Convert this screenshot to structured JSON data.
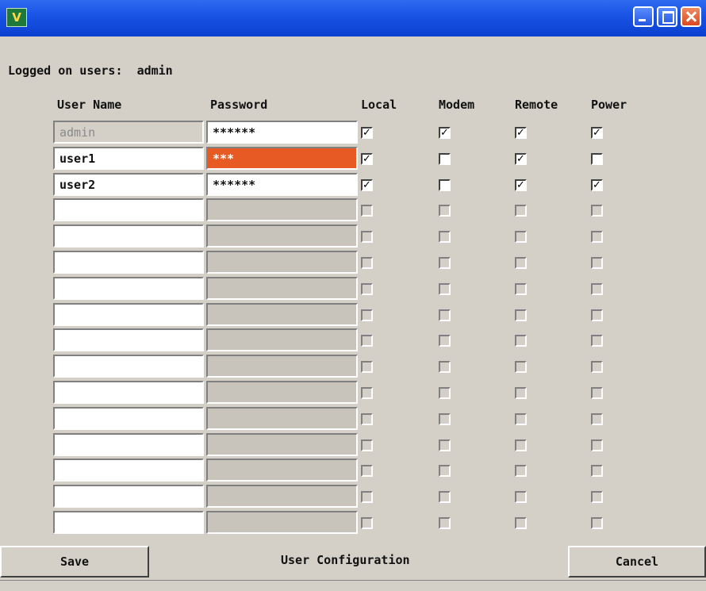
{
  "window": {
    "app_icon_text": "V",
    "logged_label": "Logged on users:",
    "logged_user": "admin",
    "caption": "User Configuration"
  },
  "columns": {
    "user_name": "User Name",
    "password": "Password",
    "local": "Local",
    "modem": "Modem",
    "remote": "Remote",
    "power": "Power"
  },
  "rows": [
    {
      "user": "admin",
      "password": "******",
      "local": true,
      "modem": true,
      "remote": true,
      "power": true,
      "state": "locked"
    },
    {
      "user": "user1",
      "password": "***",
      "local": true,
      "modem": false,
      "remote": true,
      "power": false,
      "state": "editing"
    },
    {
      "user": "user2",
      "password": "******",
      "local": true,
      "modem": false,
      "remote": true,
      "power": true,
      "state": "active"
    },
    {
      "user": "",
      "password": "",
      "local": false,
      "modem": false,
      "remote": false,
      "power": false,
      "state": "empty"
    },
    {
      "user": "",
      "password": "",
      "local": false,
      "modem": false,
      "remote": false,
      "power": false,
      "state": "empty"
    },
    {
      "user": "",
      "password": "",
      "local": false,
      "modem": false,
      "remote": false,
      "power": false,
      "state": "empty"
    },
    {
      "user": "",
      "password": "",
      "local": false,
      "modem": false,
      "remote": false,
      "power": false,
      "state": "empty"
    },
    {
      "user": "",
      "password": "",
      "local": false,
      "modem": false,
      "remote": false,
      "power": false,
      "state": "empty"
    },
    {
      "user": "",
      "password": "",
      "local": false,
      "modem": false,
      "remote": false,
      "power": false,
      "state": "empty"
    },
    {
      "user": "",
      "password": "",
      "local": false,
      "modem": false,
      "remote": false,
      "power": false,
      "state": "empty"
    },
    {
      "user": "",
      "password": "",
      "local": false,
      "modem": false,
      "remote": false,
      "power": false,
      "state": "empty"
    },
    {
      "user": "",
      "password": "",
      "local": false,
      "modem": false,
      "remote": false,
      "power": false,
      "state": "empty"
    },
    {
      "user": "",
      "password": "",
      "local": false,
      "modem": false,
      "remote": false,
      "power": false,
      "state": "empty"
    },
    {
      "user": "",
      "password": "",
      "local": false,
      "modem": false,
      "remote": false,
      "power": false,
      "state": "empty"
    },
    {
      "user": "",
      "password": "",
      "local": false,
      "modem": false,
      "remote": false,
      "power": false,
      "state": "empty"
    },
    {
      "user": "",
      "password": "",
      "local": false,
      "modem": false,
      "remote": false,
      "power": false,
      "state": "empty"
    }
  ],
  "buttons": {
    "save": "Save",
    "cancel": "Cancel"
  },
  "colors": {
    "titlebar": "#1a55e6",
    "editing_field": "#e85a24",
    "dialog_bg": "#d4d0c8"
  },
  "icons": {
    "app": "vc-app-icon",
    "minimize": "minimize-icon",
    "maximize": "maximize-icon",
    "close": "close-icon",
    "check": "check-mark"
  }
}
